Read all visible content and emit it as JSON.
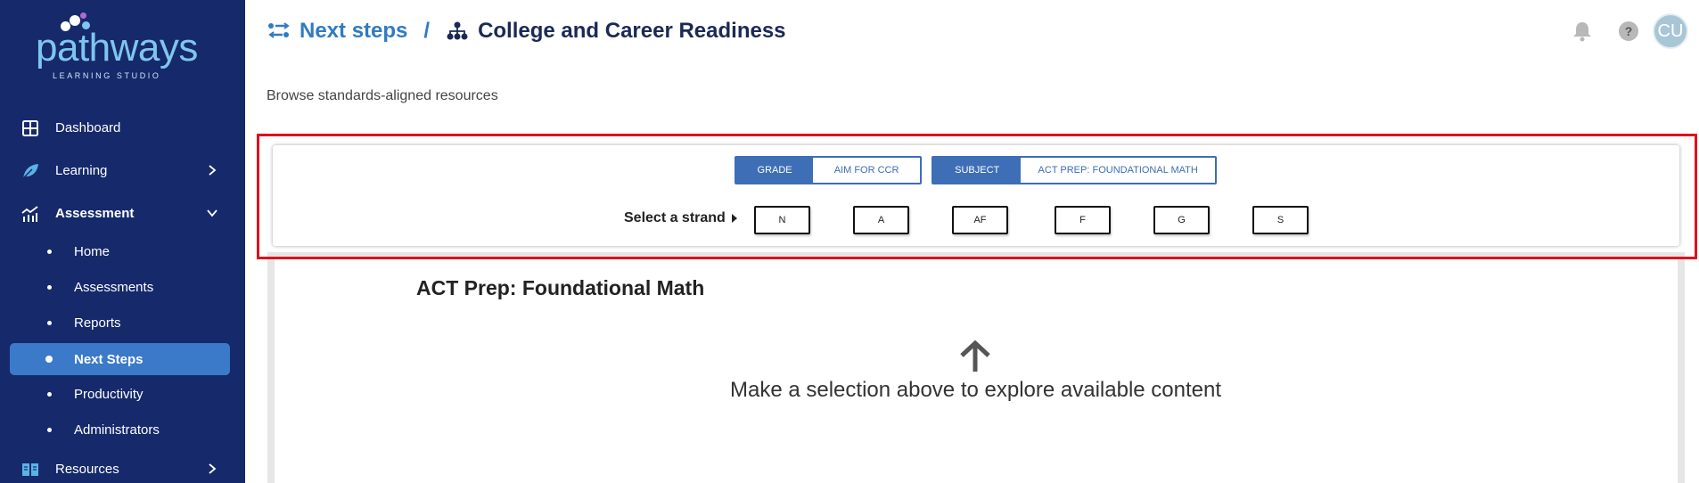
{
  "sidebar": {
    "logo": {
      "word": "pathways",
      "sub": "LEARNING STUDIO"
    },
    "nav": [
      {
        "label": "Dashboard",
        "icon": "dashboard-icon"
      },
      {
        "label": "Learning",
        "icon": "leaf-icon"
      },
      {
        "label": "Assessment",
        "icon": "chart-icon"
      },
      {
        "label": "Resources",
        "icon": "book-icon"
      }
    ],
    "assessment_items": [
      {
        "label": "Home"
      },
      {
        "label": "Assessments"
      },
      {
        "label": "Reports"
      },
      {
        "label": "Next Steps",
        "active": true
      },
      {
        "label": "Productivity"
      },
      {
        "label": "Administrators"
      }
    ]
  },
  "header": {
    "crumb1": "Next steps",
    "separator": "/",
    "crumb2": "College and Career Readiness",
    "avatar_initials": "CU"
  },
  "subtitle": "Browse standards-aligned resources",
  "filters": {
    "grade": {
      "key": "GRADE",
      "value": "AIM FOR CCR"
    },
    "subject": {
      "key": "SUBJECT",
      "value": "ACT PREP: FOUNDATIONAL MATH"
    }
  },
  "strand": {
    "label": "Select a strand",
    "options": [
      "N",
      "A",
      "AF",
      "F",
      "G",
      "S"
    ]
  },
  "content": {
    "title": "ACT Prep: Foundational Math",
    "hint": "Make a selection above to explore available content"
  },
  "colors": {
    "sidebar_bg": "#16296b",
    "active_item": "#3b7ac9",
    "accent": "#2f7bc2",
    "pill_blue": "#3e6eb5",
    "highlight_border": "#e2101a"
  }
}
